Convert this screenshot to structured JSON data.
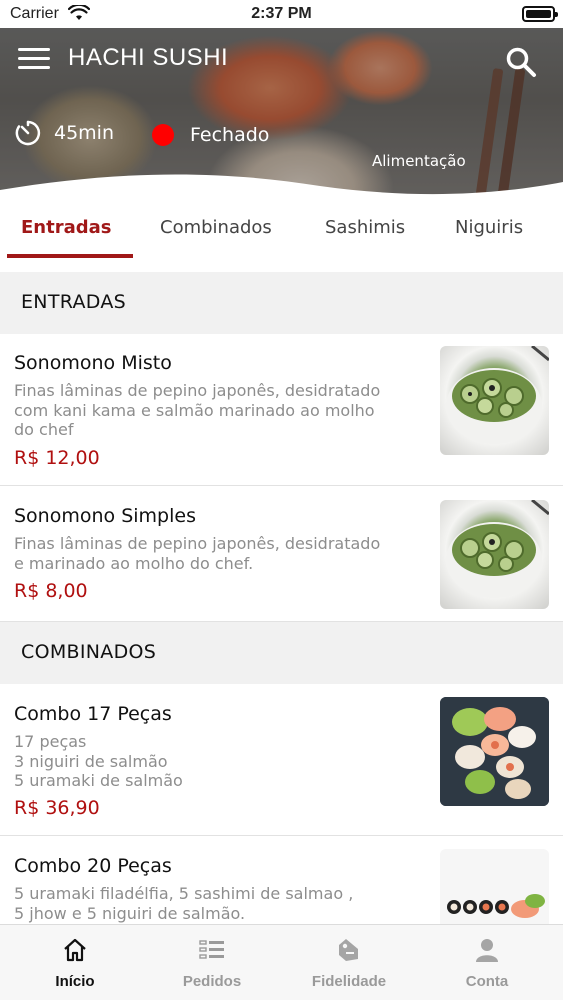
{
  "status_bar": {
    "carrier": "Carrier",
    "time": "2:37 PM"
  },
  "header": {
    "title": "HACHI SUSHI",
    "delivery_time": "45min",
    "store_status": "Fechado",
    "store_status_color": "#ff0000",
    "category": "Alimentação"
  },
  "tabs": [
    {
      "label": "Entradas",
      "active": true
    },
    {
      "label": "Combinados"
    },
    {
      "label": "Sashimis"
    },
    {
      "label": "Niguiris"
    }
  ],
  "sections": [
    {
      "title": "ENTRADAS",
      "items": [
        {
          "name": "Sonomono Misto",
          "description": [
            "Finas lâminas de pepino japonês, desidratado",
            "com kani kama e salmão marinado ao molho",
            "do chef"
          ],
          "price": "R$ 12,00"
        },
        {
          "name": "Sonomono Simples",
          "description": [
            "Finas lâminas de pepino japonês, desidratado",
            "e marinado ao molho do chef."
          ],
          "price": "R$ 8,00"
        }
      ]
    },
    {
      "title": "COMBINADOS",
      "items": [
        {
          "name": "Combo 17 Peças",
          "description": [
            "17 peças",
            "3 niguiri de salmão",
            "5 uramaki de salmão"
          ],
          "price": "R$ 36,90"
        },
        {
          "name": "Combo 20 Peças",
          "description": [
            "5 uramaki filadélfia, 5 sashimi de salmao ,",
            "5 jhow e 5 niguiri de salmão."
          ],
          "price": ""
        }
      ]
    }
  ],
  "bottom_nav": [
    {
      "label": "Início",
      "icon": "home-icon",
      "active": true
    },
    {
      "label": "Pedidos",
      "icon": "orders-icon"
    },
    {
      "label": "Fidelidade",
      "icon": "loyalty-tag-icon"
    },
    {
      "label": "Conta",
      "icon": "account-icon"
    }
  ],
  "colors": {
    "accent": "#a01818",
    "price": "#b01010",
    "status_closed": "#ff0000"
  }
}
